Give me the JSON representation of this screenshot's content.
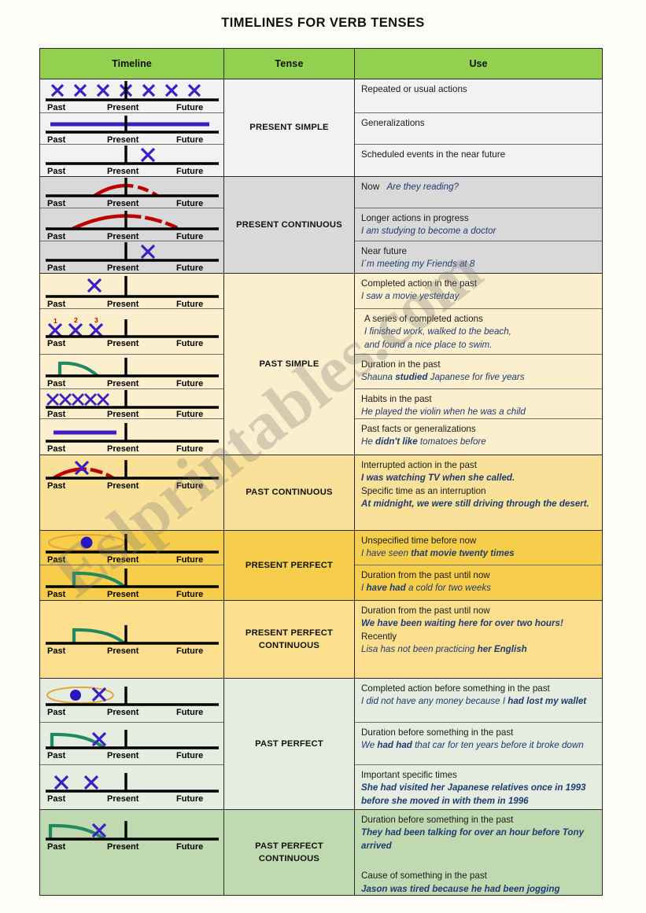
{
  "page": {
    "title": "TIMELINES FOR VERB TENSES",
    "watermark": "Eslprintables.com"
  },
  "colors": {
    "header_green": "#92d14f",
    "present_simple_bg": "#f2f2f2",
    "present_continuous_bg": "#d9d9d9",
    "past_simple_bg": "#fcefcd",
    "past_continuous_bg": "#fae199",
    "present_perfect_bg": "#f7ce4b",
    "present_perfect_continuous_bg": "#fbdf8f",
    "past_perfect_bg": "#e4eddf",
    "past_perfect_continuous_bg": "#bfd9b0",
    "x_mark": "#3b1fc4",
    "arc_red": "#c00000",
    "curve_green": "#1f8a62",
    "ellipse_orange": "#e8a33d",
    "example_text": "#1f3b73"
  },
  "header": {
    "timeline": "Timeline",
    "tense": "Tense",
    "use": "Use"
  },
  "axis_labels": {
    "past": "Past",
    "present": "Present",
    "future": "Future"
  },
  "sections": [
    {
      "id": "present-simple",
      "tense": "PRESENT SIMPLE",
      "uses": [
        {
          "lead": "Repeated or usual actions",
          "example": ""
        },
        {
          "lead": "Generalizations",
          "example": ""
        },
        {
          "lead": "Scheduled events in the near future",
          "example": ""
        }
      ],
      "timelines": [
        {
          "kind": "x-series-7"
        },
        {
          "kind": "bar-full-purple"
        },
        {
          "kind": "x-future-single"
        }
      ]
    },
    {
      "id": "present-continuous",
      "tense": "PRESENT CONTINUOUS",
      "uses": [
        {
          "lead": "Now",
          "example": "Are they reading?",
          "inline": true
        },
        {
          "lead": "Longer actions in progress",
          "example": "I am studying to become a doctor"
        },
        {
          "lead": "Near future",
          "example": "I´m meeting my Friends at 8"
        }
      ],
      "timelines": [
        {
          "kind": "arc-small-red"
        },
        {
          "kind": "arc-wide-red"
        },
        {
          "kind": "x-future-single"
        }
      ]
    },
    {
      "id": "past-simple",
      "tense": "PAST SIMPLE",
      "uses": [
        {
          "lead": "Completed action in the past",
          "example": "I saw a movie yesterday"
        },
        {
          "lead": "A series of completed actions",
          "example": "I finished work, walked to the beach,\nand found a nice place to swim."
        },
        {
          "lead": "Duration in the past",
          "example": "Shauna <b>studied</b> Japanese for five years"
        },
        {
          "lead": "Habits in the past",
          "example": "He played the violin when he was a child"
        },
        {
          "lead": "Past facts or generalizations",
          "example": "He <b>didn't like</b> tomatoes before"
        }
      ],
      "timelines": [
        {
          "kind": "x-past-single"
        },
        {
          "kind": "x-numbered-3"
        },
        {
          "kind": "curve-green-past"
        },
        {
          "kind": "x-row-5-past"
        },
        {
          "kind": "bar-past-purple"
        }
      ]
    },
    {
      "id": "past-continuous",
      "tense": "PAST CONTINUOUS",
      "uses": [
        {
          "lead": "Interrupted action in the past",
          "example": "I was watching TV when she called."
        },
        {
          "lead": "Specific time as an interruption",
          "example": "At midnight, we were still driving through the desert."
        }
      ],
      "timelines": [
        {
          "kind": "arc-red-past-with-x"
        }
      ]
    },
    {
      "id": "present-perfect",
      "tense": "PRESENT PERFECT",
      "uses": [
        {
          "lead": "Unspecified time before now",
          "example": "I have seen <b>that movie twenty times</b>"
        },
        {
          "lead": "Duration from the past until now",
          "example": "I <b>have had</b> a cold for two weeks"
        }
      ],
      "timelines": [
        {
          "kind": "ellipse-dot-past"
        },
        {
          "kind": "curve-green-to-present"
        }
      ]
    },
    {
      "id": "present-perfect-continuous",
      "tense": "PRESENT PERFECT\nCONTINUOUS",
      "uses": [
        {
          "lead": "Duration from the past until now",
          "example": "We have been waiting here for over two hours!"
        },
        {
          "lead": "Recently",
          "example": "Lisa has not been practicing <b>her English</b>"
        }
      ],
      "timelines": [
        {
          "kind": "curve-green-to-present"
        }
      ]
    },
    {
      "id": "past-perfect",
      "tense": "PAST PERFECT",
      "uses": [
        {
          "lead": "Completed action before something in the past",
          "example": "I did not have any money because I <b>had lost my wallet</b>"
        },
        {
          "lead": "Duration before something in the past",
          "example": "We <b>had had</b> that car for ten years before it broke down"
        },
        {
          "lead": "Important specific times",
          "example": "She had visited her Japanese relatives once in 1993 before she moved in with them in 1996"
        }
      ],
      "timelines": [
        {
          "kind": "ellipse-dot-x-past"
        },
        {
          "kind": "curve-green-x-past"
        },
        {
          "kind": "x-two-past"
        }
      ]
    },
    {
      "id": "past-perfect-continuous",
      "tense": "PAST PERFECT\nCONTINUOUS",
      "uses": [
        {
          "lead": "Duration before something in the past",
          "example": "They had been talking for over an hour before Tony arrived"
        },
        {
          "lead": "Cause of something in the past",
          "example": "Jason was tired because he had been jogging"
        }
      ],
      "timelines": [
        {
          "kind": "curve-green-x-past"
        }
      ]
    }
  ]
}
